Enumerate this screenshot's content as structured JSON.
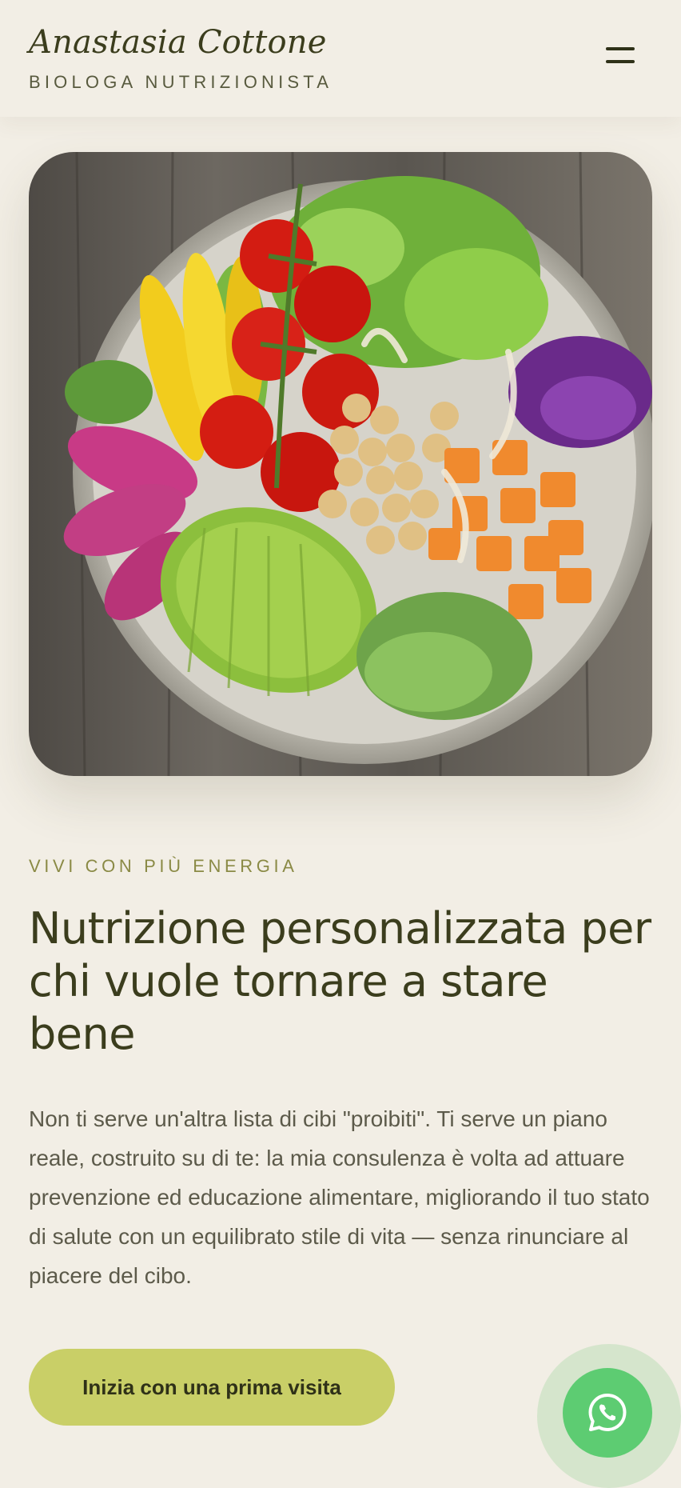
{
  "header": {
    "brand_name": "Anastasia Cottone",
    "brand_subtitle": "BIOLOGA NUTRIZIONISTA",
    "menu_icon": "hamburger-menu-icon"
  },
  "hero": {
    "image_subject": "salad-bowl-photo",
    "eyebrow": "VIVI CON PIÙ ENERGIA",
    "headline": "Nutrizione personalizzata per chi vuole tornare a stare bene",
    "lede": "Non ti serve un'altra lista di cibi \"proibiti\". Ti serve un piano reale, costruito su di te: la mia consulenza è volta ad attuare prevenzione ed educazione alimentare, migliorando il tuo stato di salute con un equilibrato stile di vita — senza rinunciare al piacere del cibo.",
    "cta_label": "Inizia con una prima visita"
  },
  "floating": {
    "whatsapp_icon": "whatsapp-icon"
  },
  "colors": {
    "background": "#f2eee5",
    "text_dark": "#3b3d1d",
    "accent_olive": "#8a8a45",
    "cta_bg": "#c9cf67",
    "whatsapp_green": "#5dcc72"
  }
}
